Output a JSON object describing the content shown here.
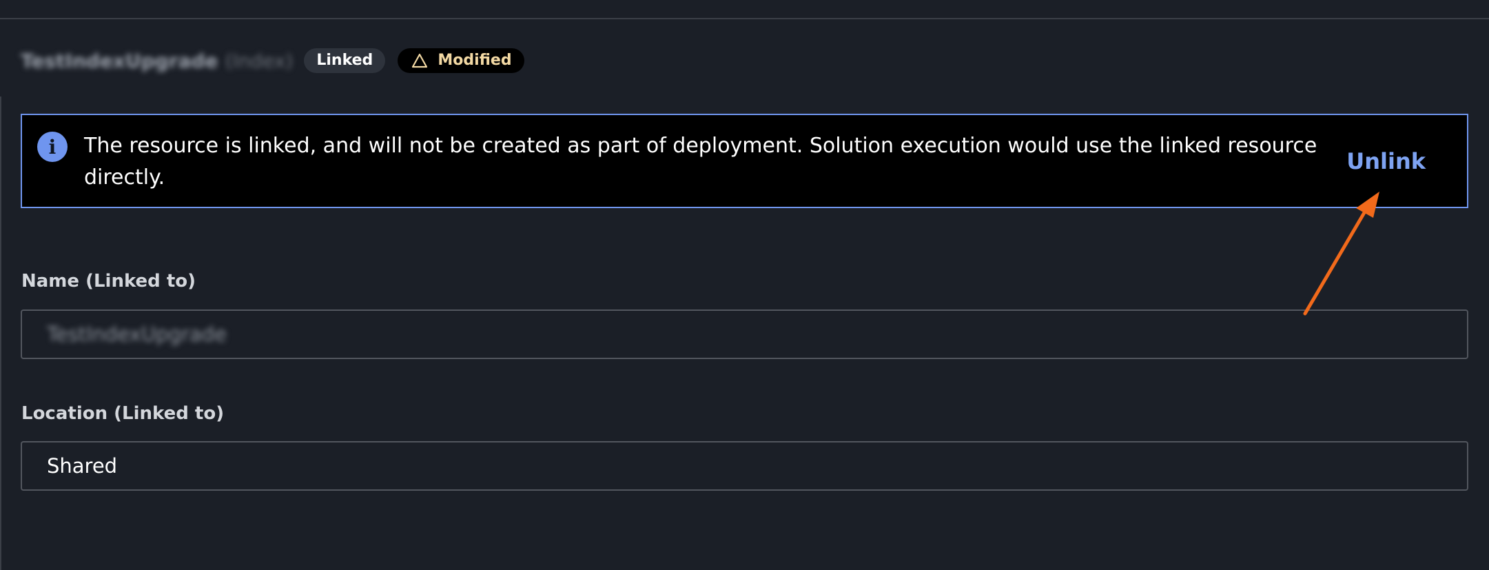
{
  "header": {
    "resource_name": "TestIndexUpgrade",
    "resource_type": "(Index)",
    "linked_badge": "Linked",
    "modified_badge": "Modified"
  },
  "banner": {
    "icon": "info-icon",
    "message": "The resource is linked, and will not be created as part of deployment. Solution execution would use the linked resource directly.",
    "action_label": "Unlink"
  },
  "fields": {
    "name_label": "Name (Linked to)",
    "name_value": "TestIndexUpgrade",
    "location_label": "Location (Linked to)",
    "location_value": "Shared"
  },
  "colors": {
    "accent": "#6f95ef",
    "annotation_arrow": "#f26a1b",
    "modified_text": "#f3d9a4"
  }
}
